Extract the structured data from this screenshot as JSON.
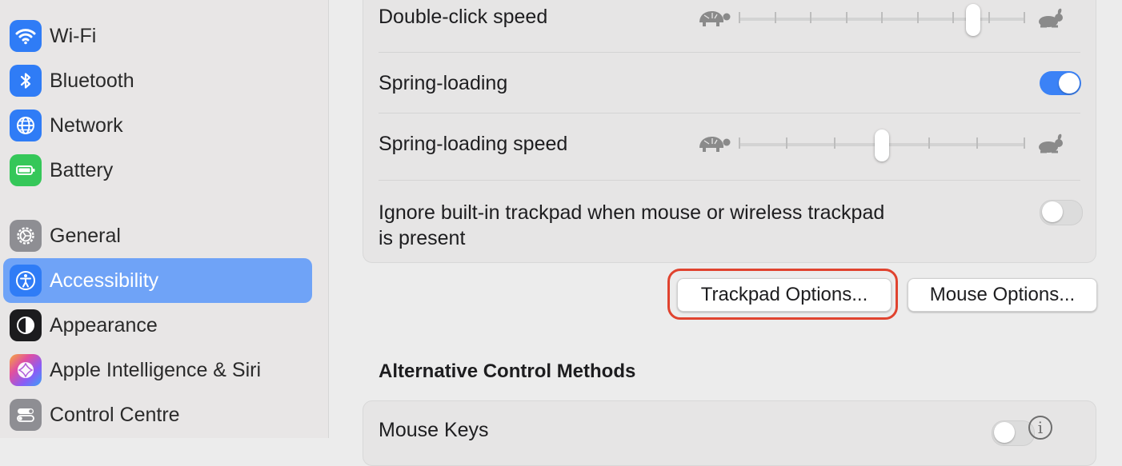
{
  "sidebar": {
    "items": [
      {
        "label": "Wi-Fi",
        "icon": "wifi-icon",
        "color": "#2f7cf6"
      },
      {
        "label": "Bluetooth",
        "icon": "bluetooth-icon",
        "color": "#2f7cf6"
      },
      {
        "label": "Network",
        "icon": "globe-icon",
        "color": "#2f7cf6"
      },
      {
        "label": "Battery",
        "icon": "battery-icon",
        "color": "#35c759"
      },
      {
        "label": "General",
        "icon": "gear-icon",
        "color": "#8e8e93"
      },
      {
        "label": "Accessibility",
        "icon": "accessibility-icon",
        "color": "#2f7cf6",
        "selected": true
      },
      {
        "label": "Appearance",
        "icon": "appearance-icon",
        "color": "#1c1c1e"
      },
      {
        "label": "Apple Intelligence & Siri",
        "icon": "siri-icon",
        "color": "#c86bf2"
      },
      {
        "label": "Control Centre",
        "icon": "control-centre-icon",
        "color": "#8e8e93"
      }
    ]
  },
  "settings": {
    "double_click_speed": {
      "label": "Double-click speed",
      "level_fraction": 0.82,
      "ticks": 9
    },
    "spring_loading": {
      "label": "Spring-loading",
      "enabled": true
    },
    "spring_loading_speed": {
      "label": "Spring-loading speed",
      "level_fraction": 0.5,
      "ticks": 7
    },
    "ignore_trackpad": {
      "label_line1": "Ignore built-in trackpad when mouse or wireless trackpad",
      "label_line2": "is present",
      "enabled": false
    }
  },
  "buttons": {
    "trackpad_options": "Trackpad Options...",
    "mouse_options": "Mouse Options..."
  },
  "alt_control": {
    "title": "Alternative Control Methods",
    "mouse_keys": {
      "label": "Mouse Keys",
      "enabled": false,
      "info": "i"
    }
  },
  "colors": {
    "accent": "#3b82f6",
    "selection": "#6fa3f7",
    "highlight_ring": "#e0432f"
  }
}
